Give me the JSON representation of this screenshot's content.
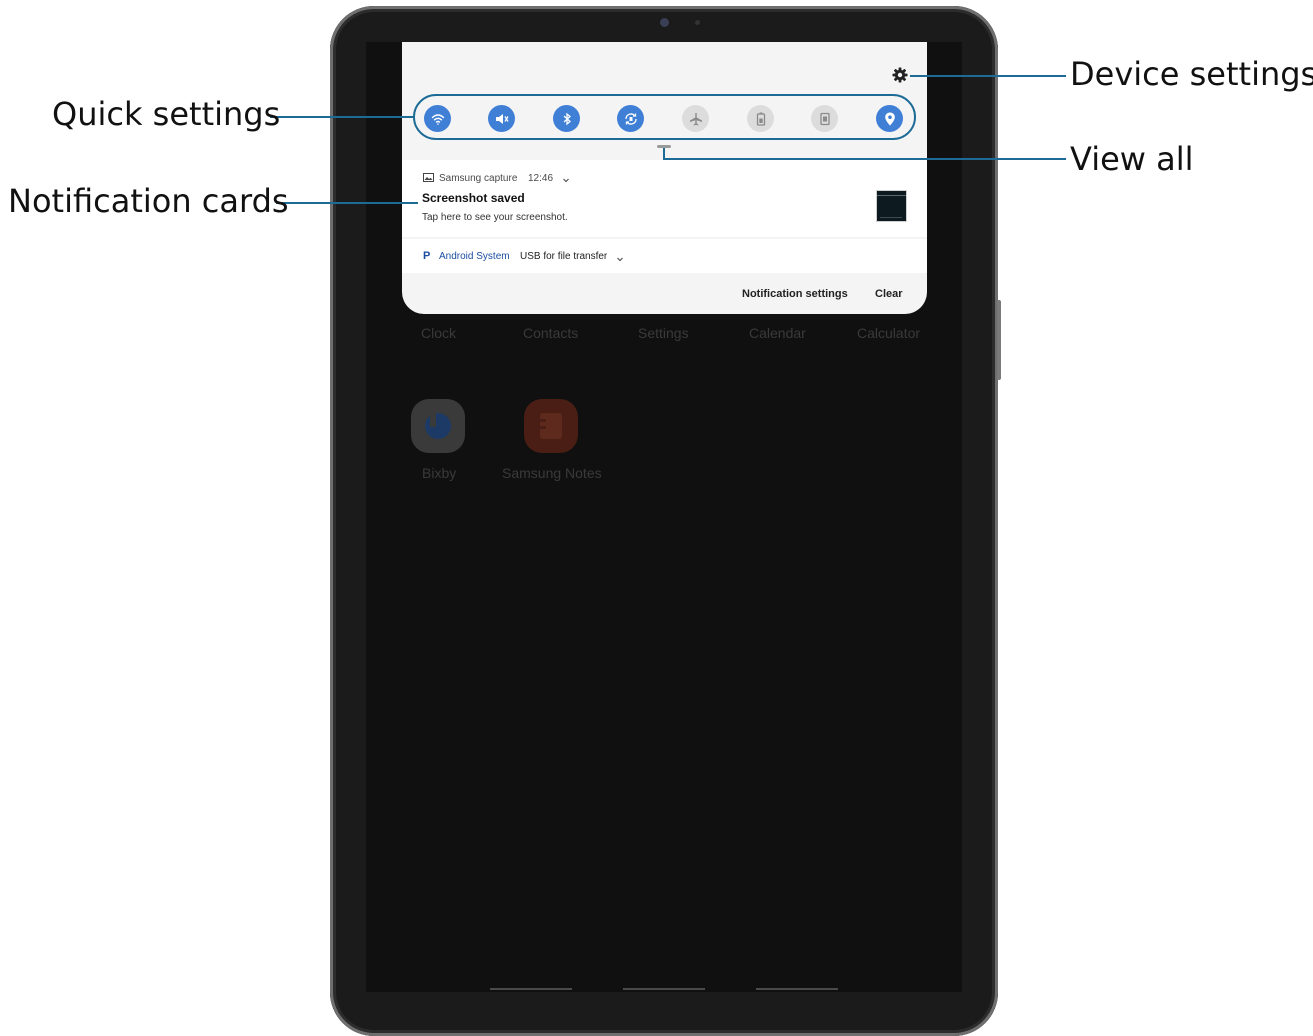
{
  "callouts": {
    "device_settings": "Device settings",
    "quick_settings": "Quick settings",
    "view_all": "View all",
    "notification_cards": "Notification cards"
  },
  "home_apps": [
    {
      "label": "Clock"
    },
    {
      "label": "Contacts"
    },
    {
      "label": "Settings"
    },
    {
      "label": "Calendar"
    },
    {
      "label": "Calculator"
    },
    {
      "label": "Bixby",
      "icon": "bixby-icon",
      "color": "#3a6fd8"
    },
    {
      "label": "Samsung Notes",
      "icon": "samsung-notes-icon",
      "color": "#e0502d"
    }
  ],
  "quick_settings": [
    {
      "icon": "wifi-icon",
      "active": true
    },
    {
      "icon": "sound-mute-icon",
      "active": true
    },
    {
      "icon": "bluetooth-icon",
      "active": true
    },
    {
      "icon": "auto-rotate-icon",
      "active": true
    },
    {
      "icon": "airplane-mode-icon",
      "active": false
    },
    {
      "icon": "power-saving-icon",
      "active": false
    },
    {
      "icon": "screen-record-icon",
      "active": false
    },
    {
      "icon": "location-icon",
      "active": true
    }
  ],
  "notifications": [
    {
      "app": "Samsung capture",
      "time": "12:46",
      "title": "Screenshot saved",
      "body": "Tap here to see your screenshot."
    },
    {
      "app": "Android System",
      "body": "USB for file transfer"
    }
  ],
  "actions": {
    "notification_settings": "Notification settings",
    "clear": "Clear"
  },
  "colors": {
    "accent": "#3f7fd6",
    "callout_line": "#1b6b96",
    "panel": "#f4f4f4"
  }
}
